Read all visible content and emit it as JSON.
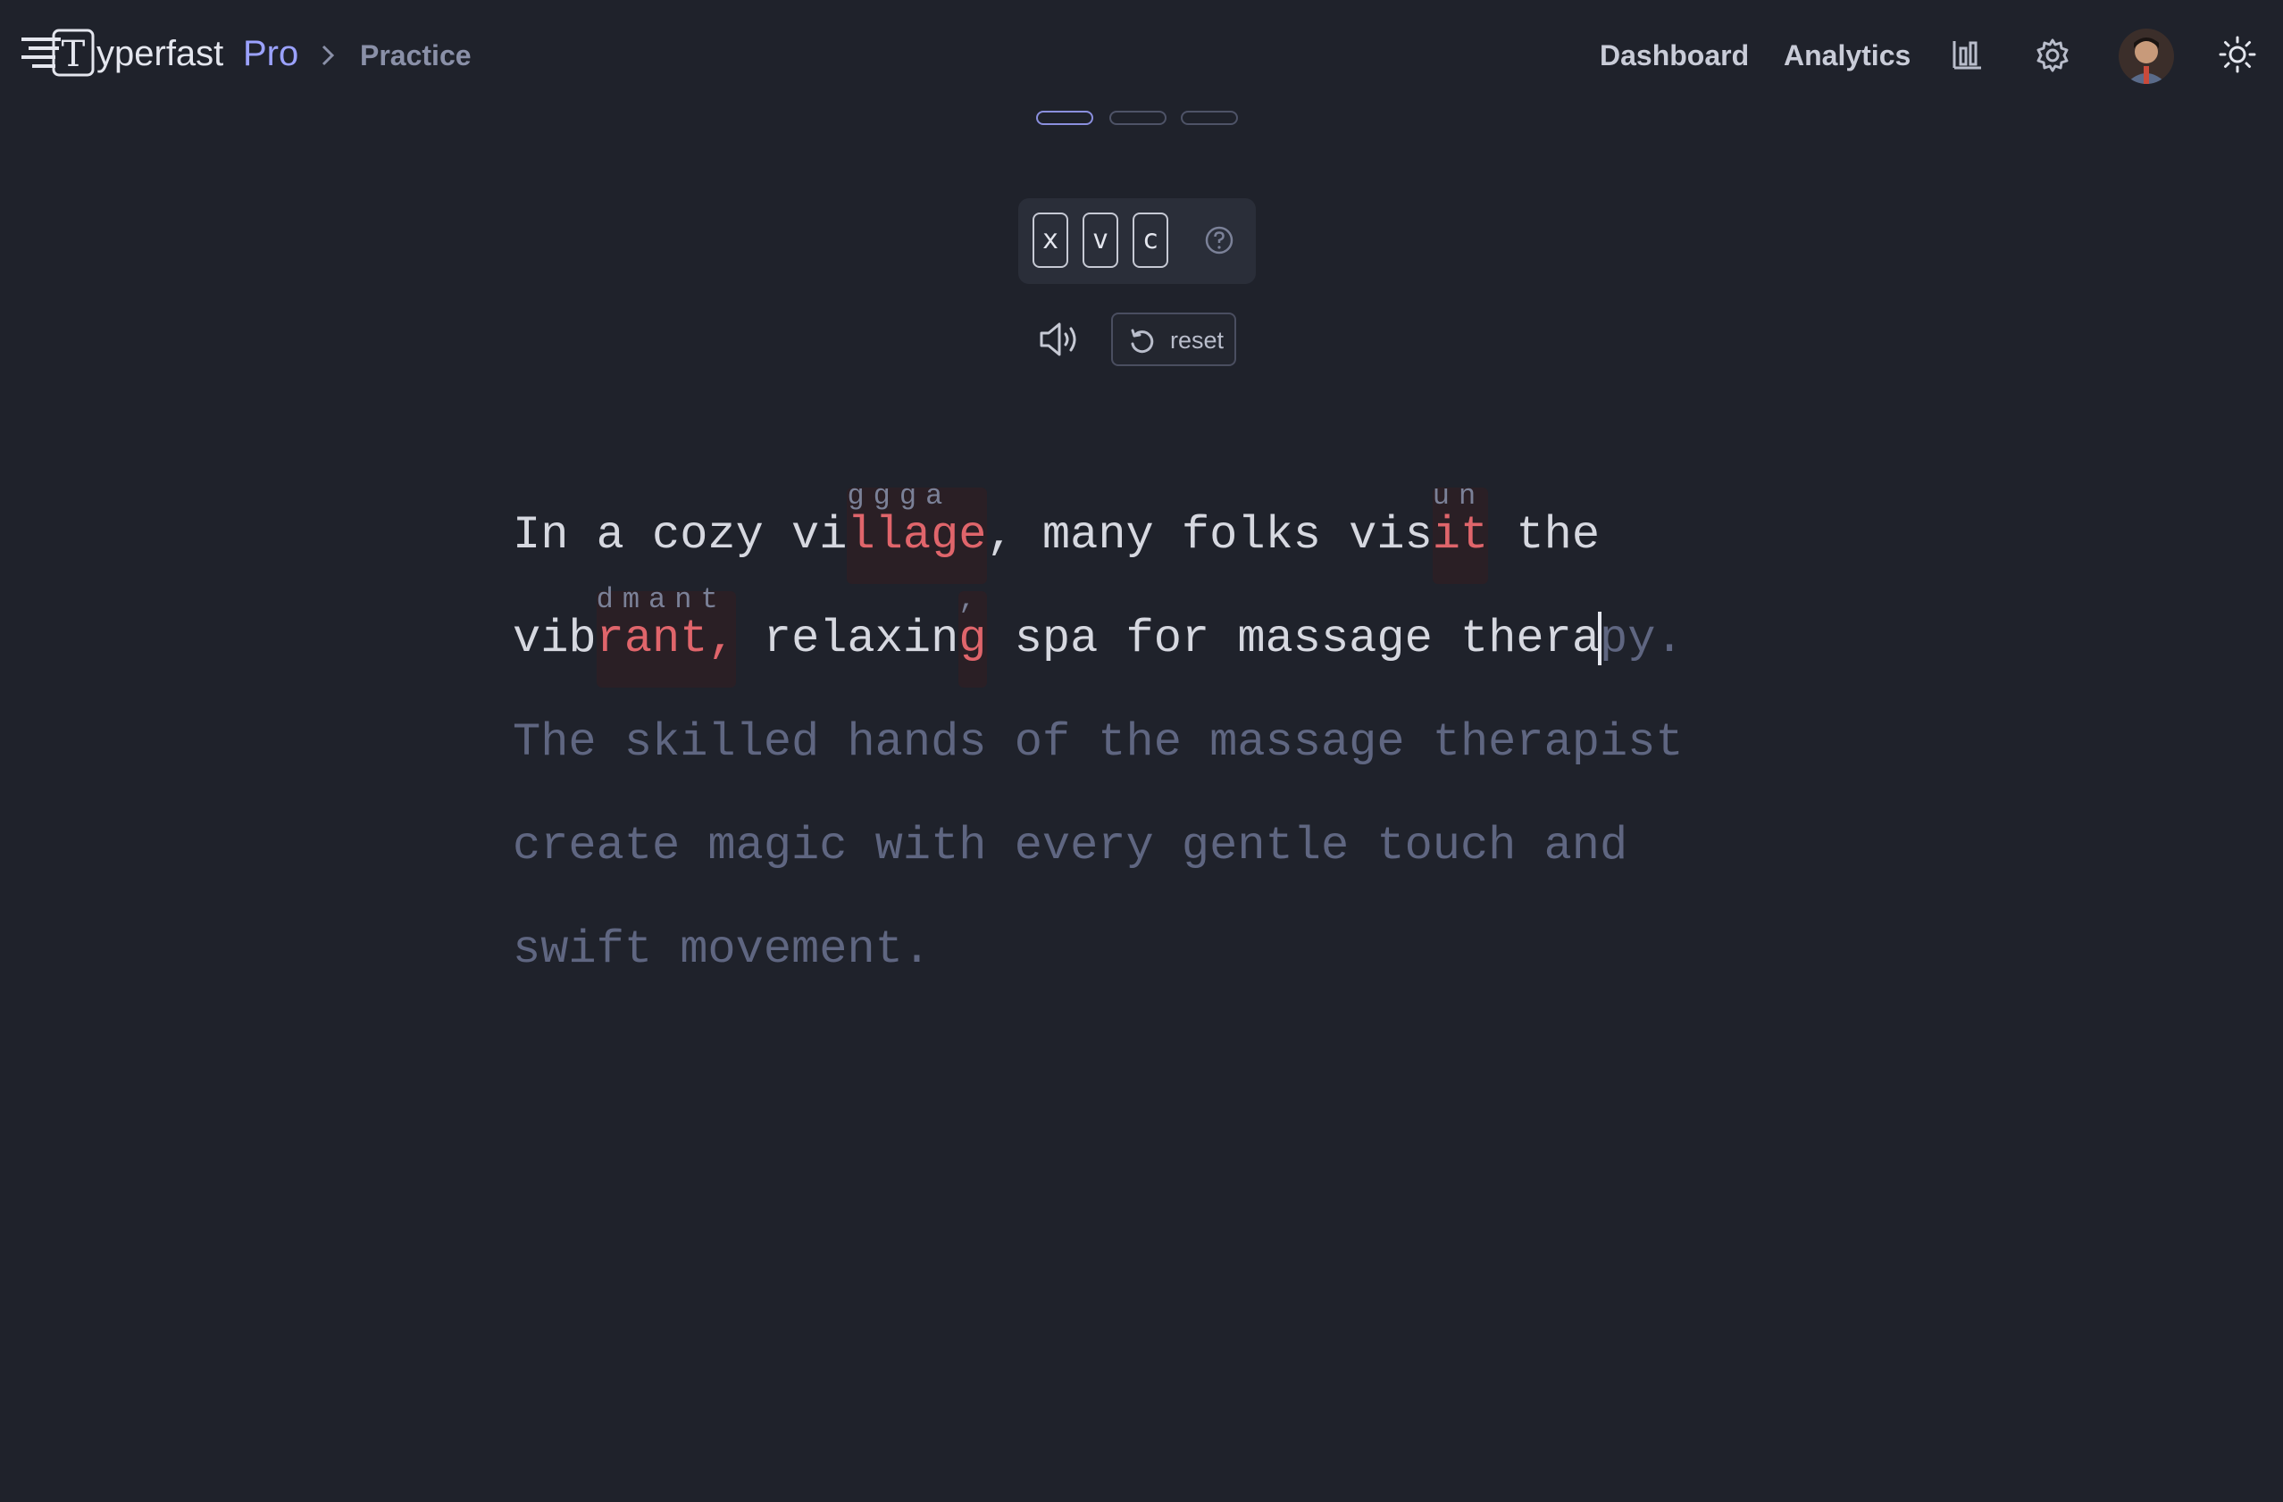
{
  "brand": {
    "name": "yperfast",
    "pro": "Pro",
    "logo_letter": "T"
  },
  "breadcrumb": {
    "current": "Practice"
  },
  "nav": {
    "dashboard": "Dashboard",
    "analytics": "Analytics"
  },
  "icons": {
    "stats": "bar-chart-icon",
    "settings": "gear-icon",
    "theme": "sun-icon",
    "help": "question-icon",
    "sound": "speaker-icon",
    "reset": "rotate-ccw-icon"
  },
  "pager": {
    "count": 3,
    "active": 1
  },
  "keys": [
    "x",
    "v",
    "c"
  ],
  "controls": {
    "reset_label": "reset"
  },
  "text": {
    "line1": {
      "t1": "In a cozy vi",
      "e1": "llage",
      "e1_over": "ggga",
      "t2": ", many folks vis",
      "e2": "it",
      "e2_over": "un",
      "t3": " the"
    },
    "line2": {
      "t1": "vib",
      "e1": "rant,",
      "e1_over": "dmant",
      "t2": " relaxin",
      "e2": "g",
      "e2_over": ",",
      "t3": " spa for massage thera",
      "p1": "py."
    },
    "line3": "The skilled hands of the massage therapist",
    "line4": "create magic with every gentle touch and",
    "line5": "swift movement."
  },
  "colors": {
    "background": "#1f222b",
    "accent": "#9ba2ff",
    "error": "#e0656b",
    "pending": "#5f6681"
  }
}
